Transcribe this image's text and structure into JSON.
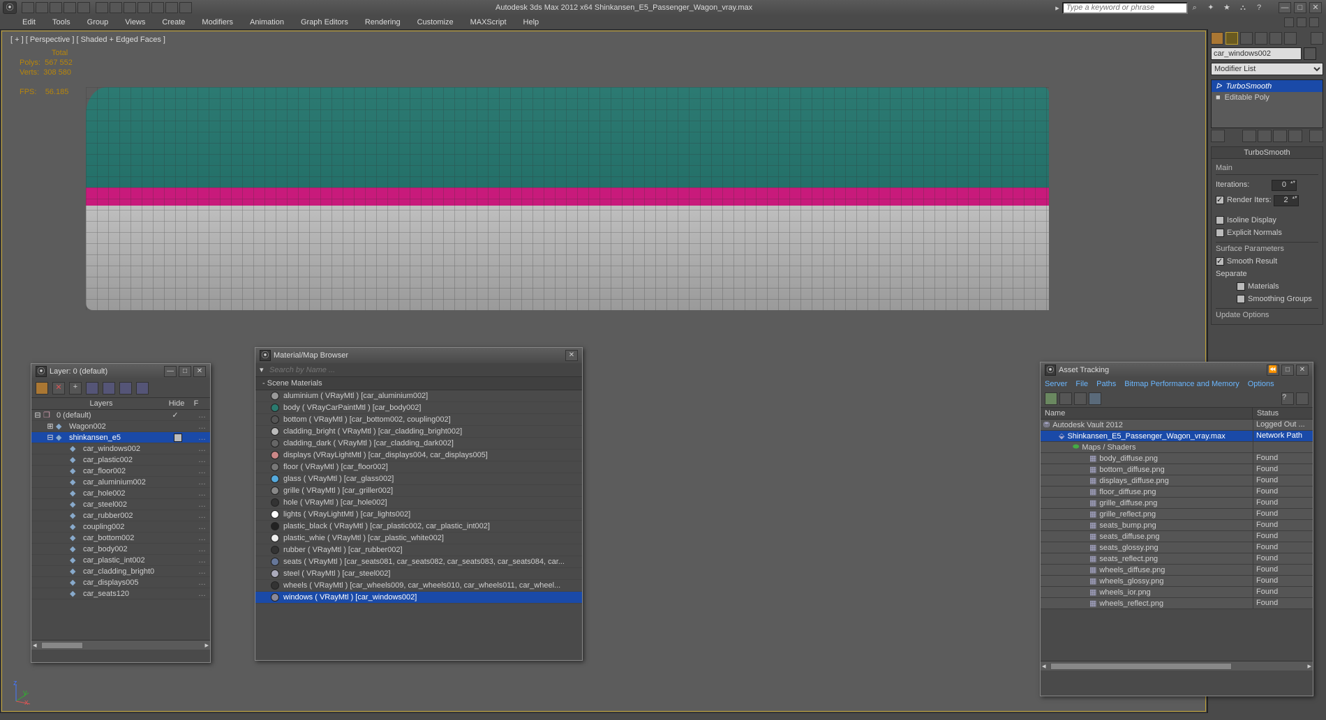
{
  "title_full": "Autodesk 3ds Max 2012 x64     Shinkansen_E5_Passenger_Wagon_vray.max",
  "search_placeholder": "Type a keyword or phrase",
  "menu": [
    "Edit",
    "Tools",
    "Group",
    "Views",
    "Create",
    "Modifiers",
    "Animation",
    "Graph Editors",
    "Rendering",
    "Customize",
    "MAXScript",
    "Help"
  ],
  "viewport": {
    "label": "[ + ] [ Perspective ] [ Shaded + Edged Faces ]"
  },
  "stats": {
    "hdr": "Total",
    "polys_lbl": "Polys:",
    "polys": "567 552",
    "verts_lbl": "Verts:",
    "verts": "308 580",
    "fps_lbl": "FPS:",
    "fps": "56.185"
  },
  "rpanel": {
    "obj_name": "car_windows002",
    "modifier_list": "Modifier List",
    "stack": [
      {
        "name": "TurboSmooth",
        "sel": true
      },
      {
        "name": "Editable Poly",
        "sel": false
      }
    ],
    "rollout1": {
      "title": "TurboSmooth",
      "main": "Main",
      "iter_lbl": "Iterations:",
      "iter": "0",
      "rend_chk": true,
      "rend_lbl": "Render Iters:",
      "rend": "2",
      "iso_chk": false,
      "iso_lbl": "Isoline Display",
      "en_chk": false,
      "en_lbl": "Explicit Normals",
      "surf_hdr": "Surface Parameters",
      "smooth_chk": true,
      "smooth_lbl": "Smooth Result",
      "sep_lbl": "Separate",
      "mat_chk": false,
      "mat_lbl": "Materials",
      "sg_chk": false,
      "sg_lbl": "Smoothing Groups",
      "upd_lbl": "Update Options"
    }
  },
  "layer_panel": {
    "title": "Layer: 0 (default)",
    "cols": {
      "name": "Layers",
      "hide": "Hide",
      "f": "F"
    },
    "rows": [
      {
        "d": 0,
        "exp": "-",
        "ic": "layer",
        "name": "0 (default)",
        "chk": true
      },
      {
        "d": 1,
        "exp": "+",
        "ic": "obj",
        "name": "Wagon002"
      },
      {
        "d": 1,
        "exp": "-",
        "ic": "obj",
        "name": "shinkansen_e5",
        "sel": true,
        "box": true
      },
      {
        "d": 2,
        "ic": "obj",
        "name": "car_windows002"
      },
      {
        "d": 2,
        "ic": "obj",
        "name": "car_plastic002"
      },
      {
        "d": 2,
        "ic": "obj",
        "name": "car_floor002"
      },
      {
        "d": 2,
        "ic": "obj",
        "name": "car_aluminium002"
      },
      {
        "d": 2,
        "ic": "obj",
        "name": "car_hole002"
      },
      {
        "d": 2,
        "ic": "obj",
        "name": "car_steel002"
      },
      {
        "d": 2,
        "ic": "obj",
        "name": "car_rubber002"
      },
      {
        "d": 2,
        "ic": "obj",
        "name": "coupling002"
      },
      {
        "d": 2,
        "ic": "obj",
        "name": "car_bottom002"
      },
      {
        "d": 2,
        "ic": "obj",
        "name": "car_body002"
      },
      {
        "d": 2,
        "ic": "obj",
        "name": "car_plastic_int002"
      },
      {
        "d": 2,
        "ic": "obj",
        "name": "car_cladding_bright0"
      },
      {
        "d": 2,
        "ic": "obj",
        "name": "car_displays005"
      },
      {
        "d": 2,
        "ic": "obj",
        "name": "car_seats120"
      }
    ]
  },
  "mat_panel": {
    "title": "Material/Map Browser",
    "search": "Search by Name ...",
    "group": "Scene Materials",
    "rows": [
      {
        "c": "#999",
        "t": "aluminium ( VRayMtl ) [car_aluminium002]"
      },
      {
        "c": "#2b7a6f",
        "t": "body ( VRayCarPaintMtl ) [car_body002]"
      },
      {
        "c": "#555",
        "t": "bottom ( VRayMtl ) [car_bottom002, coupling002]"
      },
      {
        "c": "#bbb",
        "t": "cladding_bright ( VRayMtl ) [car_cladding_bright002]"
      },
      {
        "c": "#666",
        "t": "cladding_dark ( VRayMtl ) [car_cladding_dark002]"
      },
      {
        "c": "#c88",
        "t": "displays (VRayLightMtl ) [car_displays004, car_displays005]"
      },
      {
        "c": "#777",
        "t": "floor ( VRayMtl ) [car_floor002]"
      },
      {
        "c": "#5ad",
        "t": "glass ( VRayMtl ) [car_glass002]"
      },
      {
        "c": "#888",
        "t": "grille ( VRayMtl ) [car_griller002]"
      },
      {
        "c": "#333",
        "t": "hole ( VRayMtl ) [car_hole002]"
      },
      {
        "c": "#fff",
        "t": "lights ( VRayLightMtl ) [car_lights002]"
      },
      {
        "c": "#222",
        "t": "plastic_black ( VRayMtl ) [car_plastic002, car_plastic_int002]"
      },
      {
        "c": "#eee",
        "t": "plastic_whie ( VRayMtl ) [car_plastic_white002]"
      },
      {
        "c": "#333",
        "t": "rubber ( VRayMtl ) [car_rubber002]"
      },
      {
        "c": "#679",
        "t": "seats ( VRayMtl ) [car_seats081, car_seats082, car_seats083, car_seats084, car..."
      },
      {
        "c": "#aab",
        "t": "steel ( VRayMtl ) [car_steel002]"
      },
      {
        "c": "#333",
        "t": "wheels ( VRayMtl ) [car_wheels009, car_wheels010, car_wheels011, car_wheel..."
      },
      {
        "c": "#889",
        "t": "windows ( VRayMtl ) [car_windows002]",
        "sel": true
      }
    ]
  },
  "asset_panel": {
    "title": "Asset Tracking",
    "menu": [
      "Server",
      "File",
      "Paths",
      "Bitmap Performance and Memory",
      "Options"
    ],
    "cols": {
      "name": "Name",
      "status": "Status"
    },
    "rows": [
      {
        "d": 0,
        "ic": "vault",
        "name": "Autodesk Vault 2012",
        "status": "Logged Out ..."
      },
      {
        "d": 1,
        "ic": "max",
        "name": "Shinkansen_E5_Passenger_Wagon_vray.max",
        "status": "Network Path",
        "sel": true
      },
      {
        "d": 2,
        "ic": "grp",
        "name": "Maps / Shaders",
        "status": ""
      },
      {
        "d": 3,
        "ic": "img",
        "name": "body_diffuse.png",
        "status": "Found"
      },
      {
        "d": 3,
        "ic": "img",
        "name": "bottom_diffuse.png",
        "status": "Found"
      },
      {
        "d": 3,
        "ic": "img",
        "name": "displays_diffuse.png",
        "status": "Found"
      },
      {
        "d": 3,
        "ic": "img",
        "name": "floor_diffuse.png",
        "status": "Found"
      },
      {
        "d": 3,
        "ic": "img",
        "name": "grille_diffuse.png",
        "status": "Found"
      },
      {
        "d": 3,
        "ic": "img",
        "name": "grille_reflect.png",
        "status": "Found"
      },
      {
        "d": 3,
        "ic": "img",
        "name": "seats_bump.png",
        "status": "Found"
      },
      {
        "d": 3,
        "ic": "img",
        "name": "seats_diffuse.png",
        "status": "Found"
      },
      {
        "d": 3,
        "ic": "img",
        "name": "seats_glossy.png",
        "status": "Found"
      },
      {
        "d": 3,
        "ic": "img",
        "name": "seats_reflect.png",
        "status": "Found"
      },
      {
        "d": 3,
        "ic": "img",
        "name": "wheels_diffuse.png",
        "status": "Found"
      },
      {
        "d": 3,
        "ic": "img",
        "name": "wheels_glossy.png",
        "status": "Found"
      },
      {
        "d": 3,
        "ic": "img",
        "name": "wheels_ior.png",
        "status": "Found"
      },
      {
        "d": 3,
        "ic": "img",
        "name": "wheels_reflect.png",
        "status": "Found"
      }
    ]
  }
}
